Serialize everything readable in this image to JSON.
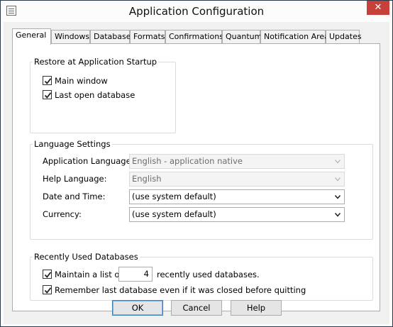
{
  "window": {
    "title": "Application Configuration",
    "close_glyph": "✕"
  },
  "tabs": [
    "General",
    "Windows",
    "Database",
    "Formats",
    "Confirmations",
    "Quantum",
    "Notification Area",
    "Updates"
  ],
  "general": {
    "startup": {
      "label": "Restore at Application Startup",
      "main_window": {
        "label": "Main window",
        "checked": true
      },
      "last_db": {
        "label": "Last open database",
        "checked": true
      }
    },
    "language": {
      "label": "Language Settings",
      "app_language": {
        "label": "Application Language:",
        "value": "English - application native",
        "enabled": false
      },
      "help_language": {
        "label": "Help Language:",
        "value": "English",
        "enabled": false
      },
      "date_time": {
        "label": "Date and Time:",
        "value": "(use system default)",
        "enabled": true
      },
      "currency": {
        "label": "Currency:",
        "value": "(use system default)",
        "enabled": true
      }
    },
    "recent": {
      "label": "Recently Used Databases",
      "maintain": {
        "label": "Maintain a list of",
        "checked": true,
        "count": "4",
        "suffix": "recently used databases."
      },
      "remember": {
        "label": "Remember last database even if it was closed before quitting",
        "checked": true
      }
    }
  },
  "buttons": {
    "ok": "OK",
    "cancel": "Cancel",
    "help": "Help"
  }
}
